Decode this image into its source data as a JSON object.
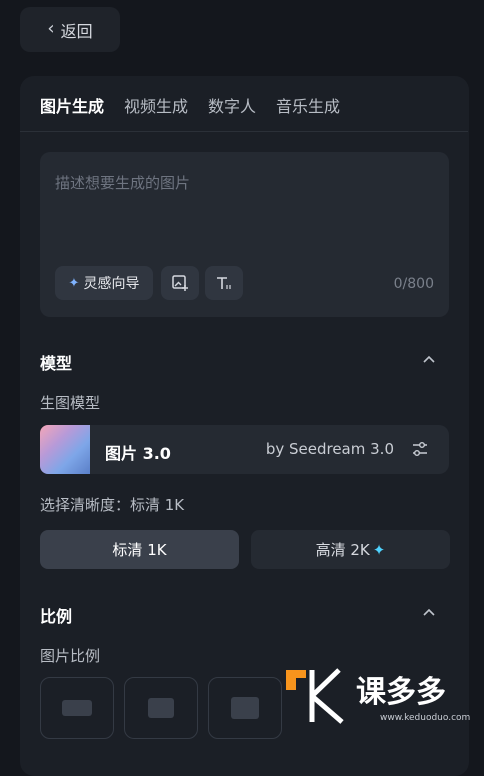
{
  "back": {
    "label": "返回"
  },
  "tabs": [
    {
      "label": "图片生成",
      "active": true
    },
    {
      "label": "视频生成",
      "active": false
    },
    {
      "label": "数字人",
      "active": false
    },
    {
      "label": "音乐生成",
      "active": false
    }
  ],
  "prompt": {
    "placeholder": "描述想要生成的图片",
    "inspire_label": "灵感向导",
    "counter": "0/800"
  },
  "model_section": {
    "title": "模型",
    "sub_label": "生图模型",
    "model_name": "图片 3.0",
    "model_by": "by Seedream 3.0",
    "resolution_label": "选择清晰度：标清 1K",
    "options": [
      {
        "label": "标清 1K",
        "selected": true
      },
      {
        "label": "高清 2K",
        "selected": false
      }
    ]
  },
  "ratio_section": {
    "title": "比例",
    "sub_label": "图片比例"
  },
  "watermark": {
    "text": "课多多",
    "sub": "www.keduoduo.com"
  },
  "colors": {
    "accent_star": "#4fd3ff",
    "panel": "#1b1f26",
    "background": "#14171d"
  }
}
